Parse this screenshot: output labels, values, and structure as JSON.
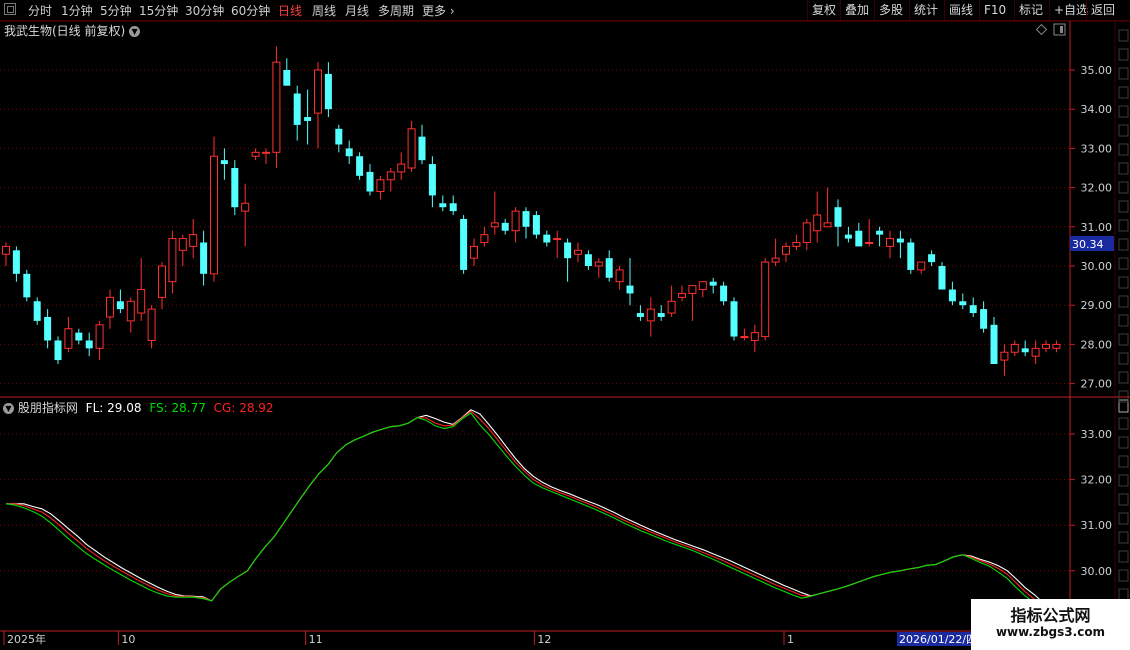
{
  "toolbar": {
    "periods": [
      "分时",
      "1分钟",
      "5分钟",
      "15分钟",
      "30分钟",
      "60分钟",
      "日线",
      "周线",
      "月线",
      "多周期",
      "更多"
    ],
    "active_period": "日线",
    "buttons": [
      "复权",
      "叠加",
      "多股",
      "统计",
      "画线",
      "F10",
      "标记",
      "+自选",
      "返回"
    ]
  },
  "stock": {
    "title": "我武生物(日线 前复权)",
    "current_price_tag": "30.34"
  },
  "price_axis": {
    "ticks": [
      "35.00",
      "34.00",
      "33.00",
      "32.00",
      "31.00",
      "30.00",
      "29.00",
      "28.00",
      "27.00"
    ]
  },
  "indicator": {
    "name": "股朋指标网",
    "fl_label": "FL: 29.08",
    "fs_label": "FS: 28.77",
    "cg_label": "CG: 28.92",
    "fl_value": 29.08,
    "fs_value": 28.77,
    "cg_value": 28.92,
    "colors": {
      "FL": "#ffffff",
      "FS": "#00dd00",
      "CG": "#ff2020"
    },
    "axis_ticks": [
      "33.00",
      "32.00",
      "31.00",
      "30.00"
    ]
  },
  "date_axis": {
    "labels": [
      {
        "text": "2025年",
        "index": 0
      },
      {
        "text": "10",
        "index": 11
      },
      {
        "text": "11",
        "index": 29
      },
      {
        "text": "12",
        "index": 51
      },
      {
        "text": "1",
        "index": 75
      }
    ],
    "highlight": "2026/01/22/四"
  },
  "watermark": {
    "title": "指标公式网",
    "url": "www.zbgs3.com"
  },
  "chart_data": {
    "type": "candlestick",
    "title": "我武生物(日线 前复权)",
    "ylim": [
      26.7,
      35.7
    ],
    "candles": [
      [
        30.3,
        30.6,
        30.0,
        30.5
      ],
      [
        30.4,
        30.5,
        29.6,
        29.8
      ],
      [
        29.8,
        29.9,
        29.1,
        29.2
      ],
      [
        29.1,
        29.2,
        28.5,
        28.6
      ],
      [
        28.7,
        28.9,
        27.9,
        28.1
      ],
      [
        28.1,
        28.2,
        27.5,
        27.6
      ],
      [
        27.9,
        28.7,
        27.8,
        28.4
      ],
      [
        28.3,
        28.4,
        28.0,
        28.1
      ],
      [
        28.1,
        28.3,
        27.7,
        27.9
      ],
      [
        27.9,
        28.6,
        27.6,
        28.5
      ],
      [
        28.7,
        29.4,
        28.4,
        29.2
      ],
      [
        29.1,
        29.4,
        28.8,
        28.9
      ],
      [
        28.6,
        29.2,
        28.3,
        29.1
      ],
      [
        28.8,
        30.2,
        28.6,
        29.4
      ],
      [
        28.1,
        29.0,
        27.9,
        28.9
      ],
      [
        29.2,
        30.1,
        28.9,
        30.0
      ],
      [
        29.6,
        30.9,
        29.3,
        30.7
      ],
      [
        30.4,
        30.8,
        30.0,
        30.7
      ],
      [
        30.5,
        31.2,
        30.2,
        30.8
      ],
      [
        30.6,
        30.9,
        29.5,
        29.8
      ],
      [
        29.8,
        33.3,
        29.6,
        32.8
      ],
      [
        32.7,
        33.0,
        32.2,
        32.6
      ],
      [
        32.5,
        32.7,
        31.3,
        31.5
      ],
      [
        31.4,
        32.1,
        30.5,
        31.6
      ],
      [
        32.8,
        33.0,
        32.7,
        32.9
      ],
      [
        32.9,
        33.0,
        32.6,
        32.9
      ],
      [
        32.9,
        35.6,
        32.5,
        35.2
      ],
      [
        35.0,
        35.3,
        34.6,
        34.6
      ],
      [
        34.4,
        34.6,
        33.2,
        33.6
      ],
      [
        33.8,
        34.5,
        33.1,
        33.7
      ],
      [
        33.9,
        35.2,
        33.0,
        35.0
      ],
      [
        34.9,
        35.2,
        33.8,
        34.0
      ],
      [
        33.5,
        33.6,
        32.9,
        33.1
      ],
      [
        33.0,
        33.2,
        32.6,
        32.8
      ],
      [
        32.8,
        32.9,
        32.2,
        32.3
      ],
      [
        32.4,
        32.6,
        31.8,
        31.9
      ],
      [
        31.9,
        32.3,
        31.7,
        32.2
      ],
      [
        32.2,
        32.5,
        31.9,
        32.4
      ],
      [
        32.4,
        32.9,
        32.2,
        32.6
      ],
      [
        32.5,
        33.7,
        32.4,
        33.5
      ],
      [
        33.3,
        33.6,
        32.6,
        32.7
      ],
      [
        32.6,
        32.8,
        31.5,
        31.8
      ],
      [
        31.6,
        31.8,
        31.4,
        31.5
      ],
      [
        31.6,
        31.8,
        31.3,
        31.4
      ],
      [
        31.2,
        31.3,
        29.8,
        29.9
      ],
      [
        30.2,
        30.7,
        30.0,
        30.5
      ],
      [
        30.6,
        31.0,
        30.5,
        30.8
      ],
      [
        31.0,
        31.9,
        30.8,
        31.1
      ],
      [
        31.1,
        31.2,
        30.8,
        30.9
      ],
      [
        30.9,
        31.5,
        30.6,
        31.4
      ],
      [
        31.4,
        31.5,
        30.7,
        31.0
      ],
      [
        31.3,
        31.4,
        30.7,
        30.8
      ],
      [
        30.8,
        30.9,
        30.5,
        30.6
      ],
      [
        30.7,
        30.9,
        30.2,
        30.7
      ],
      [
        30.6,
        30.7,
        29.6,
        30.2
      ],
      [
        30.3,
        30.6,
        30.1,
        30.4
      ],
      [
        30.3,
        30.4,
        29.9,
        30.0
      ],
      [
        30.0,
        30.2,
        29.7,
        30.1
      ],
      [
        30.2,
        30.4,
        29.6,
        29.7
      ],
      [
        29.6,
        30.0,
        29.4,
        29.9
      ],
      [
        29.5,
        30.2,
        29.0,
        29.3
      ],
      [
        28.8,
        29.0,
        28.6,
        28.7
      ],
      [
        28.6,
        29.2,
        28.2,
        28.9
      ],
      [
        28.8,
        29.0,
        28.6,
        28.7
      ],
      [
        28.8,
        29.5,
        28.7,
        29.1
      ],
      [
        29.2,
        29.5,
        29.1,
        29.3
      ],
      [
        29.3,
        29.5,
        28.6,
        29.5
      ],
      [
        29.4,
        29.6,
        29.2,
        29.6
      ],
      [
        29.6,
        29.7,
        29.3,
        29.5
      ],
      [
        29.5,
        29.6,
        29.0,
        29.1
      ],
      [
        29.1,
        29.2,
        28.1,
        28.2
      ],
      [
        28.2,
        28.4,
        28.1,
        28.2
      ],
      [
        28.1,
        28.5,
        27.8,
        28.3
      ],
      [
        28.2,
        30.2,
        28.1,
        30.1
      ],
      [
        30.1,
        30.7,
        30.0,
        30.2
      ],
      [
        30.3,
        30.6,
        30.1,
        30.5
      ],
      [
        30.5,
        30.8,
        30.4,
        30.6
      ],
      [
        30.6,
        31.2,
        30.4,
        31.1
      ],
      [
        30.9,
        31.9,
        30.6,
        31.3
      ],
      [
        31.0,
        32.0,
        31.0,
        31.1
      ],
      [
        31.5,
        31.7,
        30.5,
        31.0
      ],
      [
        30.8,
        31.0,
        30.6,
        30.7
      ],
      [
        30.9,
        31.1,
        30.7,
        30.5
      ],
      [
        30.6,
        31.2,
        30.5,
        30.6
      ],
      [
        30.9,
        31.0,
        30.5,
        30.8
      ],
      [
        30.5,
        30.9,
        30.2,
        30.7
      ],
      [
        30.7,
        30.9,
        30.2,
        30.6
      ],
      [
        30.6,
        30.7,
        29.8,
        29.9
      ],
      [
        29.9,
        30.1,
        29.8,
        30.1
      ],
      [
        30.3,
        30.4,
        30.0,
        30.1
      ],
      [
        30.0,
        30.1,
        29.4,
        29.4
      ],
      [
        29.4,
        29.6,
        29.0,
        29.1
      ],
      [
        29.1,
        29.3,
        28.9,
        29.0
      ],
      [
        29.0,
        29.2,
        28.7,
        28.8
      ],
      [
        28.9,
        29.1,
        28.3,
        28.4
      ],
      [
        28.5,
        28.7,
        27.5,
        27.5
      ],
      [
        27.6,
        28.0,
        27.2,
        27.8
      ],
      [
        27.8,
        28.1,
        27.7,
        28.0
      ],
      [
        27.9,
        28.1,
        27.7,
        27.8
      ],
      [
        27.7,
        28.1,
        27.5,
        27.9
      ],
      [
        27.9,
        28.1,
        27.8,
        28.0
      ],
      [
        27.9,
        28.1,
        27.8,
        28.0
      ]
    ],
    "indicator_ylim": [
      29.1,
      33.5
    ],
    "indicator_series": [
      {
        "name": "FL",
        "values": [
          31.47,
          31.47,
          31.47,
          31.41,
          31.36,
          31.25,
          31.09,
          30.92,
          30.76,
          30.58,
          30.44,
          30.3,
          30.18,
          30.06,
          29.95,
          29.84,
          29.74,
          29.64,
          29.55,
          29.48,
          29.45,
          29.44,
          29.43,
          29.34,
          29.6,
          29.75,
          29.88,
          30.0,
          30.28,
          30.53,
          30.75,
          31.03,
          31.32,
          31.6,
          31.88,
          32.13,
          32.33,
          32.59,
          32.76,
          32.87,
          32.95,
          33.04,
          33.1,
          33.16,
          33.18,
          33.24,
          33.36,
          33.41,
          33.34,
          33.26,
          33.21,
          33.36,
          33.53,
          33.44,
          33.21,
          32.97,
          32.71,
          32.46,
          32.24,
          32.07,
          31.94,
          31.84,
          31.76,
          31.69,
          31.61,
          31.53,
          31.46,
          31.37,
          31.28,
          31.18,
          31.09,
          31.0,
          30.91,
          30.83,
          30.75,
          30.67,
          30.6,
          30.53,
          30.46,
          30.38,
          30.3,
          30.22,
          30.13,
          30.04,
          29.95,
          29.86,
          29.77,
          29.68,
          29.6,
          29.52,
          29.45,
          29.5,
          29.55,
          29.6,
          29.66,
          29.73,
          29.8,
          29.87,
          29.92,
          29.97,
          30.0,
          30.04,
          30.07,
          30.12,
          30.14,
          30.22,
          30.31,
          30.35,
          30.32,
          30.25,
          30.19,
          30.11,
          30.0,
          29.82,
          29.63,
          29.48,
          29.3,
          29.22
        ]
      },
      {
        "name": "CG",
        "values": [
          31.47,
          31.47,
          31.43,
          31.36,
          31.29,
          31.16,
          31.0,
          30.82,
          30.66,
          30.49,
          30.35,
          30.22,
          30.1,
          29.99,
          29.88,
          29.77,
          29.67,
          29.58,
          29.5,
          29.45,
          29.44,
          29.43,
          29.41,
          29.34,
          29.6,
          29.75,
          29.88,
          30.0,
          30.28,
          30.53,
          30.75,
          31.03,
          31.32,
          31.6,
          31.88,
          32.13,
          32.33,
          32.59,
          32.76,
          32.87,
          32.95,
          33.04,
          33.1,
          33.16,
          33.18,
          33.24,
          33.36,
          33.35,
          33.24,
          33.18,
          33.19,
          33.35,
          33.5,
          33.33,
          33.12,
          32.87,
          32.62,
          32.38,
          32.18,
          32.0,
          31.88,
          31.79,
          31.71,
          31.64,
          31.56,
          31.48,
          31.4,
          31.31,
          31.22,
          31.12,
          31.03,
          30.94,
          30.86,
          30.78,
          30.7,
          30.62,
          30.55,
          30.48,
          30.4,
          30.32,
          30.24,
          30.15,
          30.06,
          29.97,
          29.88,
          29.79,
          29.7,
          29.62,
          29.54,
          29.46,
          29.44,
          29.5,
          29.55,
          29.6,
          29.66,
          29.73,
          29.8,
          29.87,
          29.92,
          29.97,
          30.0,
          30.04,
          30.07,
          30.12,
          30.14,
          30.22,
          30.31,
          30.35,
          30.3,
          30.22,
          30.15,
          30.05,
          29.92,
          29.73,
          29.54,
          29.38,
          29.22,
          29.14
        ]
      },
      {
        "name": "FS",
        "values": [
          31.47,
          31.44,
          31.38,
          31.3,
          31.2,
          31.05,
          30.88,
          30.7,
          30.54,
          30.38,
          30.25,
          30.13,
          30.01,
          29.9,
          29.79,
          29.69,
          29.59,
          29.51,
          29.45,
          29.42,
          29.42,
          29.42,
          29.39,
          29.34,
          29.6,
          29.75,
          29.88,
          30.0,
          30.28,
          30.53,
          30.75,
          31.03,
          31.32,
          31.6,
          31.88,
          32.13,
          32.33,
          32.59,
          32.76,
          32.87,
          32.95,
          33.04,
          33.1,
          33.16,
          33.18,
          33.24,
          33.36,
          33.3,
          33.18,
          33.12,
          33.16,
          33.33,
          33.46,
          33.2,
          32.99,
          32.75,
          32.51,
          32.29,
          32.09,
          31.92,
          31.82,
          31.74,
          31.66,
          31.58,
          31.5,
          31.42,
          31.34,
          31.25,
          31.16,
          31.06,
          30.97,
          30.88,
          30.8,
          30.72,
          30.64,
          30.57,
          30.5,
          30.43,
          30.34,
          30.26,
          30.17,
          30.08,
          29.99,
          29.9,
          29.81,
          29.72,
          29.63,
          29.55,
          29.47,
          29.4,
          29.44,
          29.5,
          29.55,
          29.6,
          29.66,
          29.73,
          29.8,
          29.87,
          29.92,
          29.97,
          30.0,
          30.04,
          30.07,
          30.12,
          30.14,
          30.22,
          30.31,
          30.35,
          30.27,
          30.18,
          30.1,
          29.97,
          29.83,
          29.63,
          29.45,
          29.3,
          29.14,
          29.08
        ]
      }
    ]
  }
}
